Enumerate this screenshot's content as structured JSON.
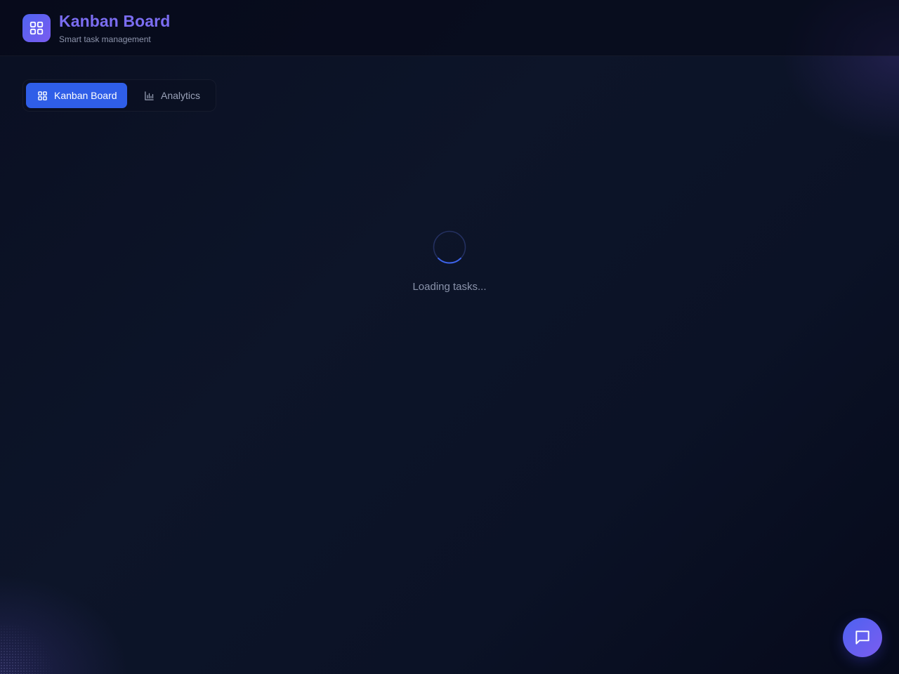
{
  "header": {
    "title": "Kanban Board",
    "subtitle": "Smart task management",
    "logo_icon": "grid-icon"
  },
  "tabs": [
    {
      "label": "Kanban Board",
      "icon": "grid-icon",
      "active": true
    },
    {
      "label": "Analytics",
      "icon": "bar-chart-icon",
      "active": false
    }
  ],
  "main": {
    "loading_text": "Loading tasks..."
  },
  "fab": {
    "icon": "chat-icon"
  },
  "colors": {
    "accent": "#2f5ee8",
    "brand_gradient_start": "#4f63f0",
    "brand_gradient_end": "#7a5cf0",
    "title": "#7b6df2",
    "background": "#0b1226"
  }
}
